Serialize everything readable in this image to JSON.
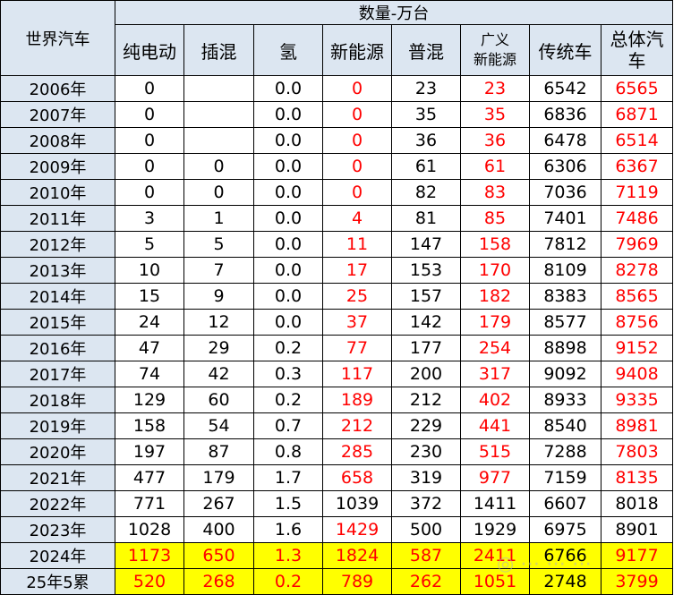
{
  "table": {
    "corner_label": "世界汽车",
    "group_title": "数量-万台",
    "columns": [
      "纯电动",
      "插混",
      "氢",
      "新能源",
      "普混",
      "广义新能源",
      "传统车",
      "总体汽车"
    ],
    "column_lines": {
      "guangyi_line1": "广义",
      "guangyi_line2": "新能源",
      "total_line1": "总体汽",
      "total_line2": "车"
    },
    "rows": [
      {
        "year": "2006年",
        "bev": "0",
        "phev": "",
        "h2": "0.0",
        "nev": "0",
        "hev": "23",
        "broad_nev": "23",
        "ice": "6542",
        "total": "6565"
      },
      {
        "year": "2007年",
        "bev": "0",
        "phev": "",
        "h2": "0.0",
        "nev": "0",
        "hev": "35",
        "broad_nev": "35",
        "ice": "6836",
        "total": "6871"
      },
      {
        "year": "2008年",
        "bev": "0",
        "phev": "",
        "h2": "0.0",
        "nev": "0",
        "hev": "36",
        "broad_nev": "36",
        "ice": "6478",
        "total": "6514"
      },
      {
        "year": "2009年",
        "bev": "0",
        "phev": "0",
        "h2": "0.0",
        "nev": "0",
        "hev": "61",
        "broad_nev": "61",
        "ice": "6306",
        "total": "6367"
      },
      {
        "year": "2010年",
        "bev": "0",
        "phev": "0",
        "h2": "0.0",
        "nev": "0",
        "hev": "82",
        "broad_nev": "83",
        "ice": "7036",
        "total": "7119"
      },
      {
        "year": "2011年",
        "bev": "3",
        "phev": "1",
        "h2": "0.0",
        "nev": "4",
        "hev": "81",
        "broad_nev": "85",
        "ice": "7401",
        "total": "7486"
      },
      {
        "year": "2012年",
        "bev": "5",
        "phev": "5",
        "h2": "0.0",
        "nev": "11",
        "hev": "147",
        "broad_nev": "158",
        "ice": "7812",
        "total": "7969"
      },
      {
        "year": "2013年",
        "bev": "10",
        "phev": "7",
        "h2": "0.0",
        "nev": "17",
        "hev": "153",
        "broad_nev": "170",
        "ice": "8109",
        "total": "8278"
      },
      {
        "year": "2014年",
        "bev": "15",
        "phev": "9",
        "h2": "0.0",
        "nev": "25",
        "hev": "157",
        "broad_nev": "182",
        "ice": "8383",
        "total": "8565"
      },
      {
        "year": "2015年",
        "bev": "24",
        "phev": "12",
        "h2": "0.0",
        "nev": "37",
        "hev": "142",
        "broad_nev": "179",
        "ice": "8577",
        "total": "8756"
      },
      {
        "year": "2016年",
        "bev": "47",
        "phev": "29",
        "h2": "0.2",
        "nev": "77",
        "hev": "177",
        "broad_nev": "254",
        "ice": "8898",
        "total": "9152"
      },
      {
        "year": "2017年",
        "bev": "74",
        "phev": "42",
        "h2": "0.3",
        "nev": "117",
        "hev": "200",
        "broad_nev": "317",
        "ice": "9092",
        "total": "9408"
      },
      {
        "year": "2018年",
        "bev": "129",
        "phev": "60",
        "h2": "0.2",
        "nev": "189",
        "hev": "212",
        "broad_nev": "402",
        "ice": "8933",
        "total": "9335"
      },
      {
        "year": "2019年",
        "bev": "158",
        "phev": "54",
        "h2": "0.7",
        "nev": "212",
        "hev": "229",
        "broad_nev": "441",
        "ice": "8540",
        "total": "8981"
      },
      {
        "year": "2020年",
        "bev": "197",
        "phev": "87",
        "h2": "0.8",
        "nev": "285",
        "hev": "230",
        "broad_nev": "515",
        "ice": "7288",
        "total": "7803"
      },
      {
        "year": "2021年",
        "bev": "477",
        "phev": "179",
        "h2": "1.7",
        "nev": "658",
        "hev": "319",
        "broad_nev": "977",
        "ice": "7159",
        "total": "8135"
      },
      {
        "year": "2022年",
        "bev": "771",
        "phev": "267",
        "h2": "1.5",
        "nev": "1039",
        "hev": "372",
        "broad_nev": "1411",
        "ice": "6607",
        "total": "8018"
      },
      {
        "year": "2023年",
        "bev": "1028",
        "phev": "400",
        "h2": "1.6",
        "nev": "1429",
        "hev": "500",
        "broad_nev": "1929",
        "ice": "6975",
        "total": "8901"
      },
      {
        "year": "2024年",
        "bev": "1173",
        "phev": "650",
        "h2": "1.3",
        "nev": "1824",
        "hev": "587",
        "broad_nev": "2411",
        "ice": "6766",
        "total": "9177"
      },
      {
        "year": "25年5累",
        "bev": "520",
        "phev": "268",
        "h2": "0.2",
        "nev": "789",
        "hev": "262",
        "broad_nev": "1051",
        "ice": "2748",
        "total": "3799"
      }
    ]
  },
  "colors": {
    "header_bg": "#dce6f1",
    "highlight_bg": "#ffff00",
    "red_text": "#ff0000",
    "black_text": "#000000"
  }
}
